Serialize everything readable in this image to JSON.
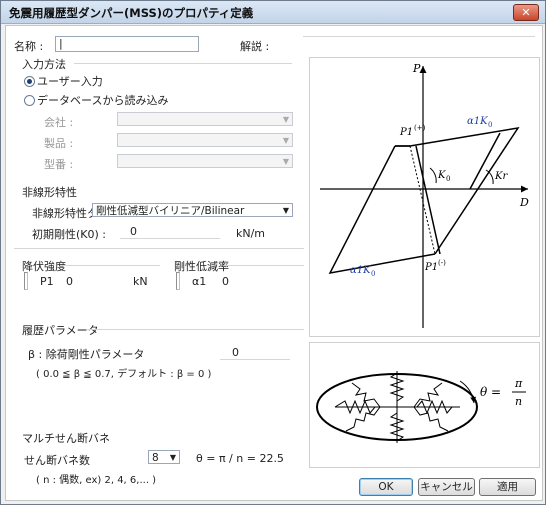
{
  "window": {
    "title": "免震用履歴型ダンパー(MSS)のプロパティ定義",
    "close": "✕"
  },
  "name": {
    "label": "名称 :",
    "value": "|"
  },
  "desc": {
    "label": "解説 :",
    "value": ""
  },
  "input_method": {
    "label": "入力方法",
    "option_user": "ユーザー入力",
    "option_db": "データベースから読み込み",
    "company_label": "会社 :",
    "product_label": "製品 :",
    "model_label": "型番 :"
  },
  "nonlinear": {
    "section": "非線形特性",
    "type_label": "非線形特性タ",
    "type_value": "剛性低減型バイリニア/Bilinear",
    "k0_label": "初期剛性(K0) :",
    "k0_value": "0",
    "k0_unit": "kN/m"
  },
  "yield": {
    "section": "降伏強度",
    "label": "P1",
    "value": "0",
    "unit": "kN"
  },
  "stiffness_reduction": {
    "section": "剛性低減率",
    "label": "α1",
    "value": "0"
  },
  "hysteresis": {
    "section": "履歴パラメータ",
    "beta_label": "β : 除荷剛性パラメータ",
    "beta_value": "0",
    "note": "( 0.0 ≦ β ≦ 0.7, デフォルト : β = 0 )"
  },
  "multi_shear": {
    "section": "マルチせん断バネ",
    "count_label": "せん断バネ数",
    "count_value": "8",
    "formula": "θ = π / n = 22.5",
    "note": "( n : 偶数, ex) 2, 4, 6,... )"
  },
  "buttons": {
    "ok": "OK",
    "cancel": "キャンセル",
    "apply": "適用"
  },
  "diagram": {
    "P": "P",
    "D": "D",
    "P1_pos": "P1",
    "P1_pos_sup": "(+)",
    "P1_neg": "P1",
    "P1_neg_sup": "(-)",
    "a1K0_top": "α1K",
    "a1K0_bot": "α1K",
    "k0_sub": "0",
    "K0": "K",
    "Kr": "Kr"
  },
  "spring_diagram": {
    "theta": "θ =",
    "pi": "π",
    "n": "n"
  }
}
